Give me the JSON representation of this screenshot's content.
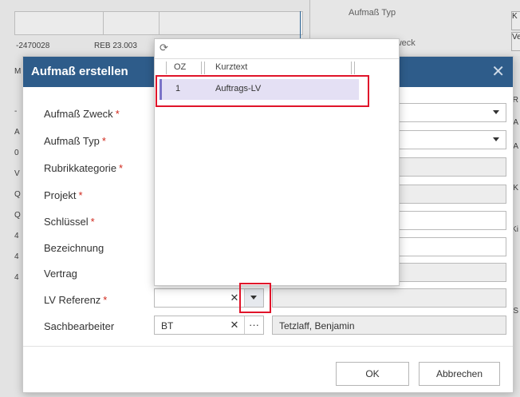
{
  "background": {
    "row_values": [
      "-2470028",
      "REB 23.003"
    ],
    "right_labels": [
      "Aufmaß Typ",
      "Zweck"
    ],
    "right_box_texts": [
      "K",
      "Ve"
    ],
    "left_strip": [
      "M",
      "-",
      "A",
      "0",
      "V",
      "Q",
      "Q",
      "4",
      "4",
      "4"
    ],
    "right_strip": [
      "R",
      "A",
      "A",
      "K",
      "Ki",
      "S"
    ]
  },
  "dialog": {
    "title": "Aufmaß erstellen",
    "close_glyph": "✕",
    "fields": [
      {
        "label": "Aufmaß Zweck",
        "required": true
      },
      {
        "label": "Aufmaß Typ",
        "required": true
      },
      {
        "label": "Rubrikkategorie",
        "required": true
      },
      {
        "label": "Projekt",
        "required": true
      },
      {
        "label": "Schlüssel",
        "required": true
      },
      {
        "label": "Bezeichnung",
        "required": false
      },
      {
        "label": "Vertrag",
        "required": false
      },
      {
        "label": "LV Referenz",
        "required": true
      },
      {
        "label": "Sachbearbeiter",
        "required": false
      }
    ],
    "required_marker": "*",
    "lv_referenz": {
      "value": "",
      "clear_glyph": "✕"
    },
    "sachbearbeiter": {
      "code": "BT",
      "clear_glyph": "✕",
      "more_glyph": "···",
      "name": "Tetzlaff, Benjamin"
    },
    "ok_label": "OK",
    "cancel_label": "Abbrechen"
  },
  "popup": {
    "refresh_glyph": "⟳",
    "columns": [
      "OZ",
      "Kurztext"
    ],
    "rows": [
      {
        "oz": "1",
        "kurztext": "Auftrags-LV"
      }
    ]
  },
  "colors": {
    "header": "#2e5c8a",
    "required": "#d0281c",
    "highlight": "#e0142a",
    "selected_row": "#e4e0f4"
  }
}
